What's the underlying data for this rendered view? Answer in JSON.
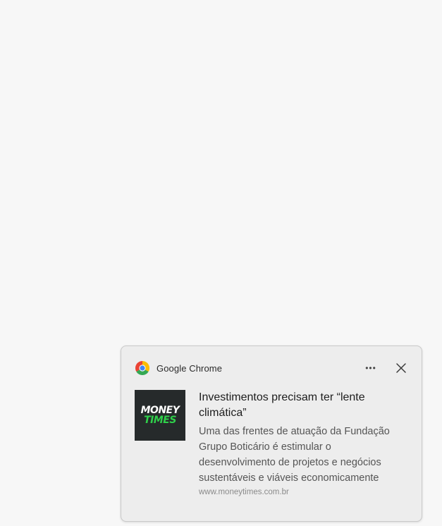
{
  "notification": {
    "app_name": "Google Chrome",
    "more_label": "•••",
    "thumbnail": {
      "line1": "MONEY",
      "line2": "TIMES"
    },
    "title": "Investimentos precisam ter “lente climática”",
    "body": "Uma das frentes de atuação da Fundação Grupo Boticário é estimular o desenvolvimento de projetos e negócios sustentáveis e viáveis economicamente",
    "source": "www.moneytimes.com.br",
    "icons": {
      "app": "chrome-icon",
      "more": "more-icon",
      "close": "close-icon"
    }
  },
  "colors": {
    "background": "#f7f7f7",
    "card": "#ededed",
    "thumbnail_bg": "#262a2b",
    "thumbnail_accent": "#2fd04a"
  }
}
